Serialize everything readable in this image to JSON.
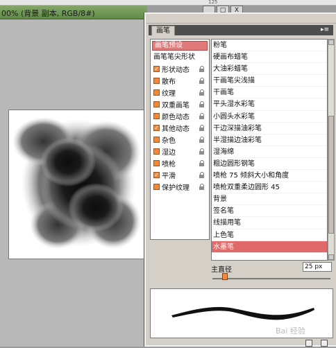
{
  "document": {
    "title": "00% (背景 副本, RGB/8#)"
  },
  "top_strip": {
    "text": "125"
  },
  "panel": {
    "tab_label": "画笔",
    "tab_menu_glyph": "▸≡",
    "preset_button": "画笔预设",
    "tip_shape_label": "画笔笔尖形状",
    "options": [
      {
        "label": "形状动态",
        "checked": true
      },
      {
        "label": "散布",
        "checked": false
      },
      {
        "label": "纹理",
        "checked": false
      },
      {
        "label": "双重画笔",
        "checked": false
      },
      {
        "label": "颜色动态",
        "checked": false
      },
      {
        "label": "其他动态",
        "checked": true
      },
      {
        "label": "杂色",
        "checked": false
      },
      {
        "label": "湿边",
        "checked": false
      },
      {
        "label": "喷枪",
        "checked": false
      },
      {
        "label": "平滑",
        "checked": true
      },
      {
        "label": "保护纹理",
        "checked": false
      }
    ],
    "brushes": [
      "粉笔",
      "硬画布蜡笔",
      "大油彩蜡笔",
      "干画笔尖浅描",
      "干画笔",
      "平头湿水彩笔",
      "小圆头水彩笔",
      "干边深描油彩笔",
      "半湿描边油彩笔",
      "湿海绵",
      "粗边圆形钢笔",
      "喷枪 75 倾斜大小和角度",
      "喷枪双重柔边圆形 45",
      "背景",
      "签名笔",
      "线描用笔",
      "上色笔",
      "水墨笔"
    ],
    "selected_brush_index": 17,
    "diameter_label": "主直径",
    "diameter_value": "25 px",
    "diameter_slider_fraction": 0.1,
    "accent_color": "#e06a6a",
    "checkbox_color": "#f08a3a"
  },
  "window_controls": [
    "_",
    "□",
    "X"
  ],
  "watermark": "Bai 经验"
}
